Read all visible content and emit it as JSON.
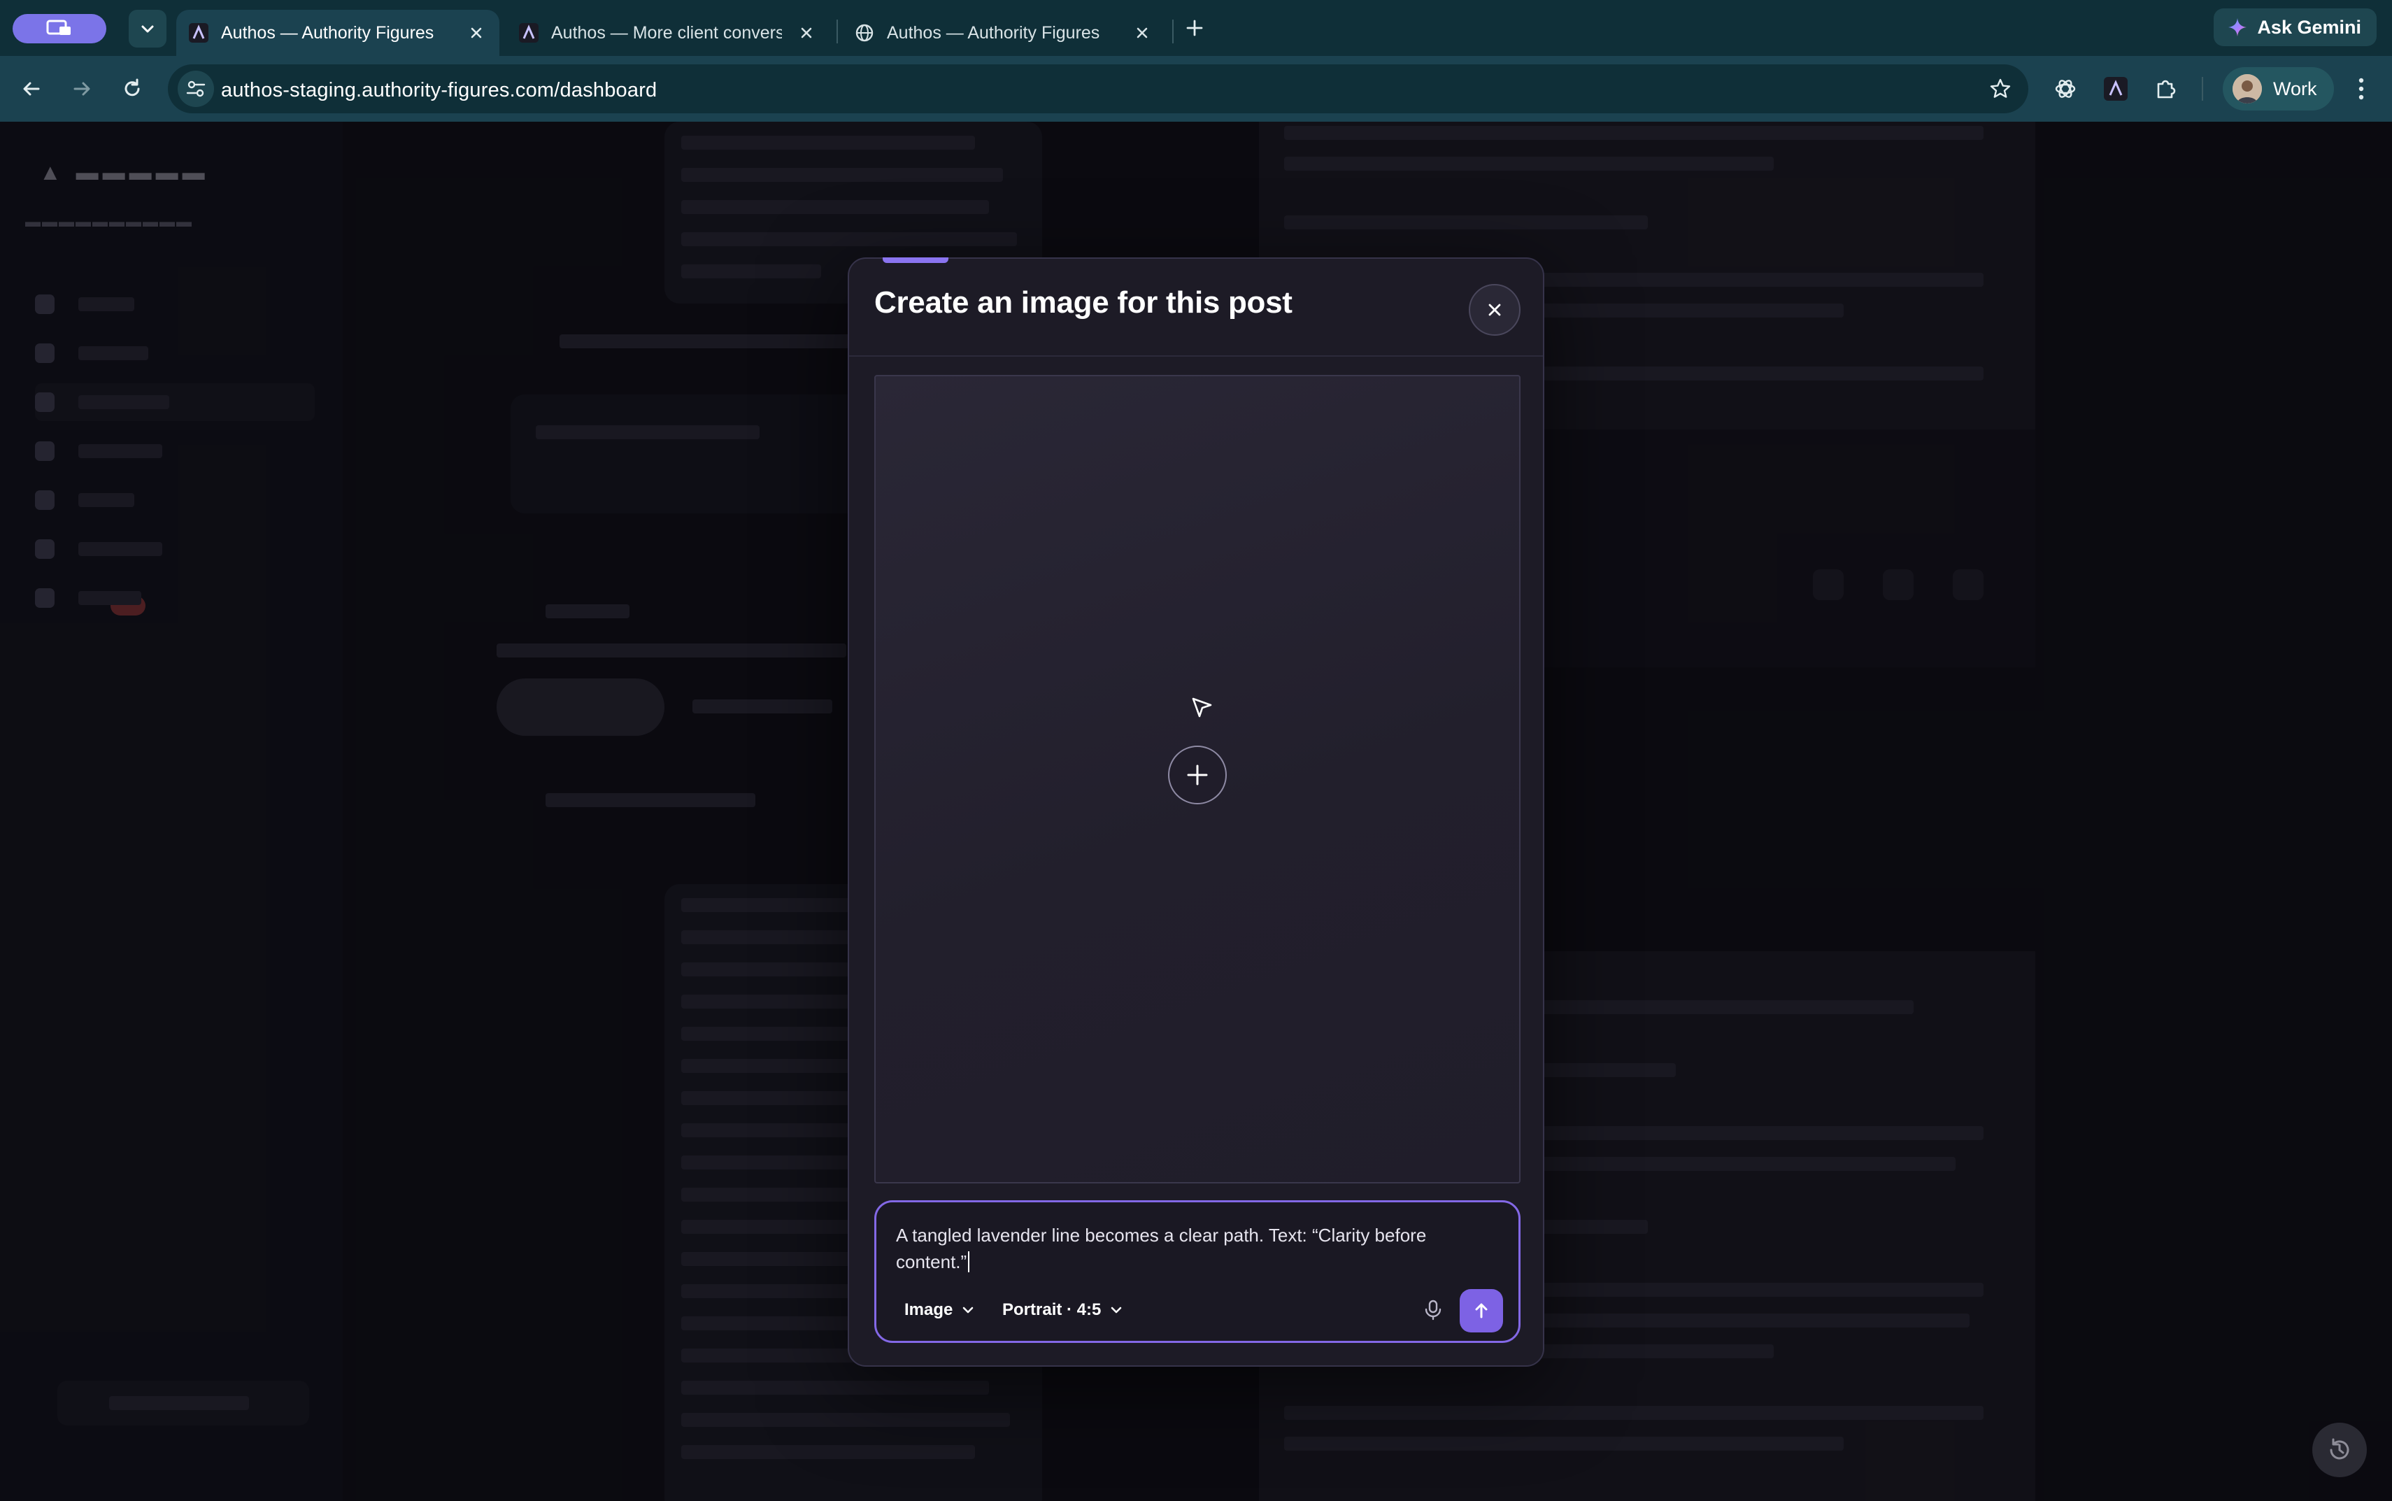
{
  "browser": {
    "tabs": [
      {
        "title": "Authos — Authority Figures",
        "active": true
      },
      {
        "title": "Authos — More client convers",
        "active": false
      },
      {
        "title": "Authos — Authority Figures",
        "active": false
      }
    ],
    "url": "authos-staging.authority-figures.com/dashboard",
    "ask_gemini_label": "Ask Gemini",
    "profile_label": "Work"
  },
  "modal": {
    "title": "Create an image for this post",
    "prompt_value": "A tangled lavender line becomes a clear path. Text: “Clarity before content.”",
    "mode_label": "Image",
    "ratio_label": "Portrait · 4:5"
  },
  "colors": {
    "accent": "#7d62e4",
    "composer_border": "#8368e6",
    "modal_bg": "#1d1b26",
    "chrome_bg": "#0f2f38"
  },
  "icons": [
    "tab-list-icon",
    "chevron-down-icon",
    "authos-logo-icon",
    "globe-icon",
    "close-icon",
    "plus-icon",
    "back-icon",
    "forward-icon",
    "reload-icon",
    "site-info-icon",
    "star-icon",
    "openai-icon",
    "extensions-icon",
    "kebab-icon",
    "gemini-icon",
    "cursor-icon",
    "mic-icon",
    "send-arrow-icon",
    "history-icon"
  ]
}
